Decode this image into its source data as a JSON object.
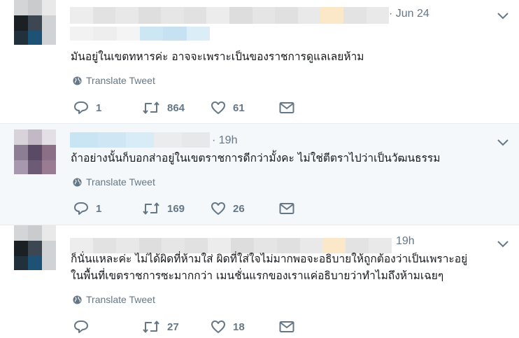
{
  "tweets": [
    {
      "time": "· Jun 24",
      "text": "มันอยู่ในเขตทหารค่ะ อาจจะเพราะเป็นของราชการดูแลเลยห้าม",
      "translate_label": "Translate Tweet",
      "replies": "1",
      "retweets": "864",
      "likes": "61"
    },
    {
      "time": "· 19h",
      "text": "ถ้าอย่างนั้นก็บอกส่าอยู่ในเขตราชการดีกว่ามั้งคะ ไม่ใช่ตีตราไปว่าเป็นวัฒนธรรม",
      "translate_label": "Translate Tweet",
      "replies": "1",
      "retweets": "169",
      "likes": "26"
    },
    {
      "time": "19h",
      "text": "ก็นั่นแหละค่ะ ไม่ได้ผิดที่ห้ามใส่ ผิดที่ใส่ใจไม่มากพอจะอธิบายให้ถูกต้องว่าเป็นเพราะอยู่\nในพื้นที่เขตราชการซะมากกว่า เมนชั่นแรกของเราแค่อธิบายว่าทำไมถึงห้ามเฉยๆ",
      "translate_label": "Translate Tweet",
      "replies": "",
      "retweets": "27",
      "likes": "18"
    }
  ],
  "icons": {
    "reply": "reply-icon",
    "retweet": "retweet-icon",
    "like": "heart-icon",
    "dm": "envelope-icon",
    "more": "chevron-down-icon",
    "translate": "globe-icon"
  },
  "colors": {
    "thread_line": "#9fd9ef",
    "icon_gray": "#657786",
    "highlight_bg": "#f5f8fa",
    "divider": "#e6ecf0"
  }
}
